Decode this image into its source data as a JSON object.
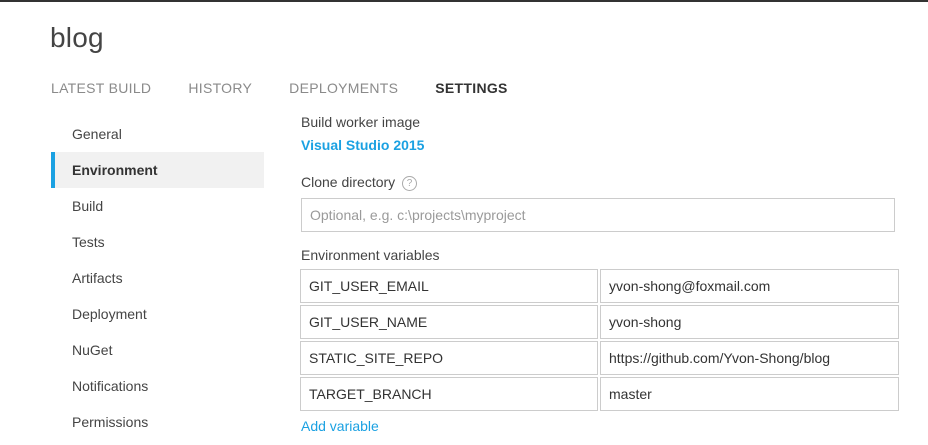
{
  "project": {
    "title": "blog"
  },
  "tabs": [
    {
      "label": "LATEST BUILD"
    },
    {
      "label": "HISTORY"
    },
    {
      "label": "DEPLOYMENTS"
    },
    {
      "label": "SETTINGS"
    }
  ],
  "active_tab": "SETTINGS",
  "sidebar": {
    "items": [
      {
        "label": "General"
      },
      {
        "label": "Environment"
      },
      {
        "label": "Build"
      },
      {
        "label": "Tests"
      },
      {
        "label": "Artifacts"
      },
      {
        "label": "Deployment"
      },
      {
        "label": "NuGet"
      },
      {
        "label": "Notifications"
      },
      {
        "label": "Permissions"
      }
    ],
    "active": "Environment"
  },
  "settings": {
    "worker_image_label": "Build worker image",
    "worker_image_value": "Visual Studio 2015",
    "clone_dir_label": "Clone directory",
    "clone_dir_help": "?",
    "clone_dir_value": "",
    "clone_dir_placeholder": "Optional, e.g. c:\\projects\\myproject",
    "env_vars_label": "Environment variables",
    "env_vars": [
      {
        "name": "GIT_USER_EMAIL",
        "value": "yvon-shong@foxmail.com"
      },
      {
        "name": "GIT_USER_NAME",
        "value": "yvon-shong"
      },
      {
        "name": "STATIC_SITE_REPO",
        "value": "https://github.com/Yvon-Shong/blog"
      },
      {
        "name": "TARGET_BRANCH",
        "value": "master"
      }
    ],
    "add_variable_label": "Add variable"
  },
  "colors": {
    "accent": "#1ba1e2",
    "active_bg": "#f1f1f1",
    "border": "#cccccc"
  }
}
